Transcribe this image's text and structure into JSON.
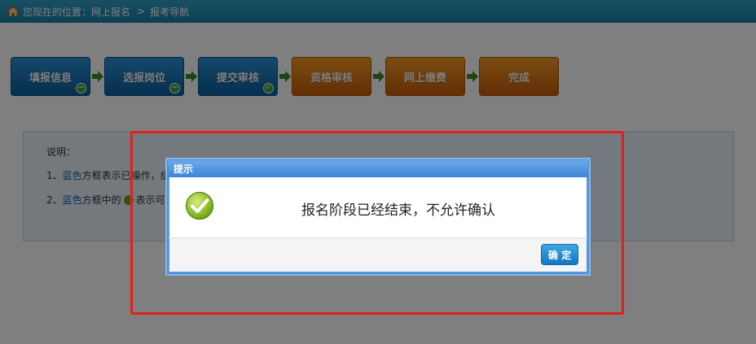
{
  "breadcrumb": {
    "prefix": "您现在的位置：",
    "items": [
      "网上报名",
      "报考导航"
    ],
    "separator": ">"
  },
  "steps": [
    {
      "label": "填报信息",
      "color": "blue",
      "mark": "−"
    },
    {
      "label": "选报岗位",
      "color": "blue",
      "mark": "−"
    },
    {
      "label": "提交审核",
      "color": "blue",
      "mark": "✓"
    },
    {
      "label": "资格审核",
      "color": "orange",
      "mark": ""
    },
    {
      "label": "网上缴费",
      "color": "orange",
      "mark": ""
    },
    {
      "label": "完成",
      "color": "orange",
      "mark": ""
    }
  ],
  "notes": {
    "title": "说明：",
    "line1_prefix": "1、",
    "line1_blue": "蓝色",
    "line1_rest": "方框表示已操作，组",
    "line2_prefix": "2、",
    "line2_blue": "蓝色",
    "line2_mid": "方框中的",
    "line2_rest": "表示可"
  },
  "dialog": {
    "title": "提示",
    "message": "报名阶段已经结束，不允许确认",
    "ok_label": "确 定",
    "icon": "check-circle-icon"
  },
  "colors": {
    "topbar": "#1a7ea6",
    "step_blue": "#0a5e9e",
    "step_orange": "#c85c0a",
    "highlight": "#e0201a",
    "dialog_border": "#4a8fd6"
  }
}
